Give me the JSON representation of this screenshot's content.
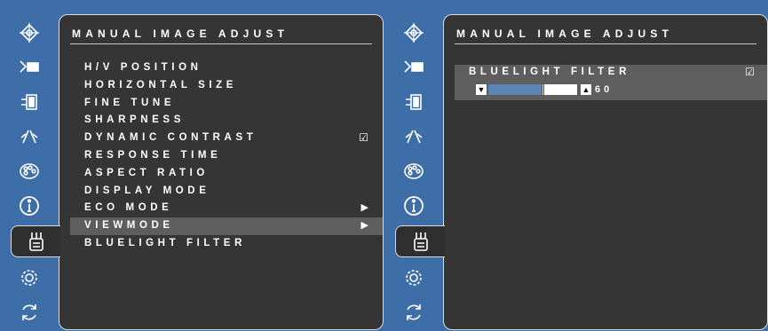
{
  "left_osd": {
    "title": "MANUAL IMAGE ADJUST",
    "items": [
      {
        "label": "H/V POSITION",
        "mark": ""
      },
      {
        "label": "HORIZONTAL SIZE",
        "mark": ""
      },
      {
        "label": "FINE TUNE",
        "mark": ""
      },
      {
        "label": "SHARPNESS",
        "mark": ""
      },
      {
        "label": "DYNAMIC CONTRAST",
        "mark": "☑"
      },
      {
        "label": "RESPONSE TIME",
        "mark": ""
      },
      {
        "label": "ASPECT RATIO",
        "mark": ""
      },
      {
        "label": "DISPLAY MODE",
        "mark": ""
      },
      {
        "label": "ECO MODE",
        "mark": "▶"
      },
      {
        "label": "VIEWMODE",
        "mark": "▶"
      },
      {
        "label": "BLUELIGHT FILTER",
        "mark": ""
      }
    ],
    "selected_index": 9
  },
  "right_osd": {
    "title": "MANUAL IMAGE ADJUST",
    "selected_item": "BLUELIGHT FILTER",
    "checkbox": "☑",
    "slider": {
      "value": "60",
      "fraction": 0.6,
      "down_glyph": "▼",
      "up_glyph": "▲"
    }
  },
  "icons": [
    "input-select-icon",
    "audio-adjust-icon",
    "color-adjust-icon",
    "manual-image-adjust-icon",
    "setup-menu-icon",
    "information-icon",
    "viewmode-icon",
    "settings-gear-icon",
    "memory-recall-icon"
  ],
  "colors": {
    "frame_blue": "#3d6ea8",
    "panel": "#353535",
    "highlight": "#5e5e5e",
    "slider_fill": "#5b86b5"
  }
}
